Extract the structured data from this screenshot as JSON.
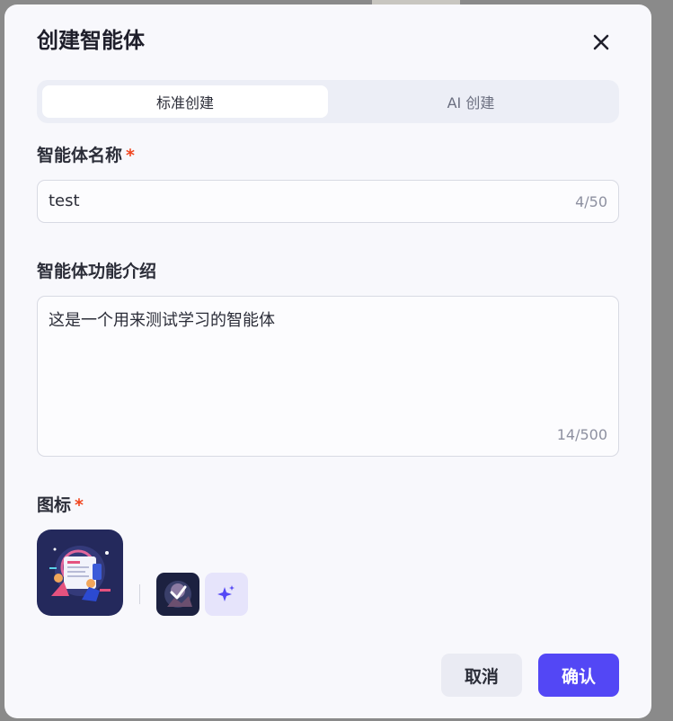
{
  "dialog": {
    "title": "创建智能体",
    "close_icon": "close-icon"
  },
  "tabs": [
    {
      "label": "标准创建",
      "active": true
    },
    {
      "label": "AI 创建",
      "active": false
    }
  ],
  "name_field": {
    "label": "智能体名称",
    "required_mark": "*",
    "value": "test",
    "counter": "4/50"
  },
  "description_field": {
    "label": "智能体功能介绍",
    "value": "这是一个用来测试学习的智能体",
    "counter": "14/500"
  },
  "icon_field": {
    "label": "图标",
    "required_mark": "*",
    "selected_icon": "robot-illustration-avatar",
    "alternate_icon": "robot-illustration-avatar-small",
    "generate_icon": "sparkle-icon"
  },
  "footer": {
    "cancel_label": "取消",
    "confirm_label": "确认"
  },
  "colors": {
    "accent": "#5347f5",
    "required": "#f0451e",
    "dialog_bg": "#f8f8fc"
  }
}
